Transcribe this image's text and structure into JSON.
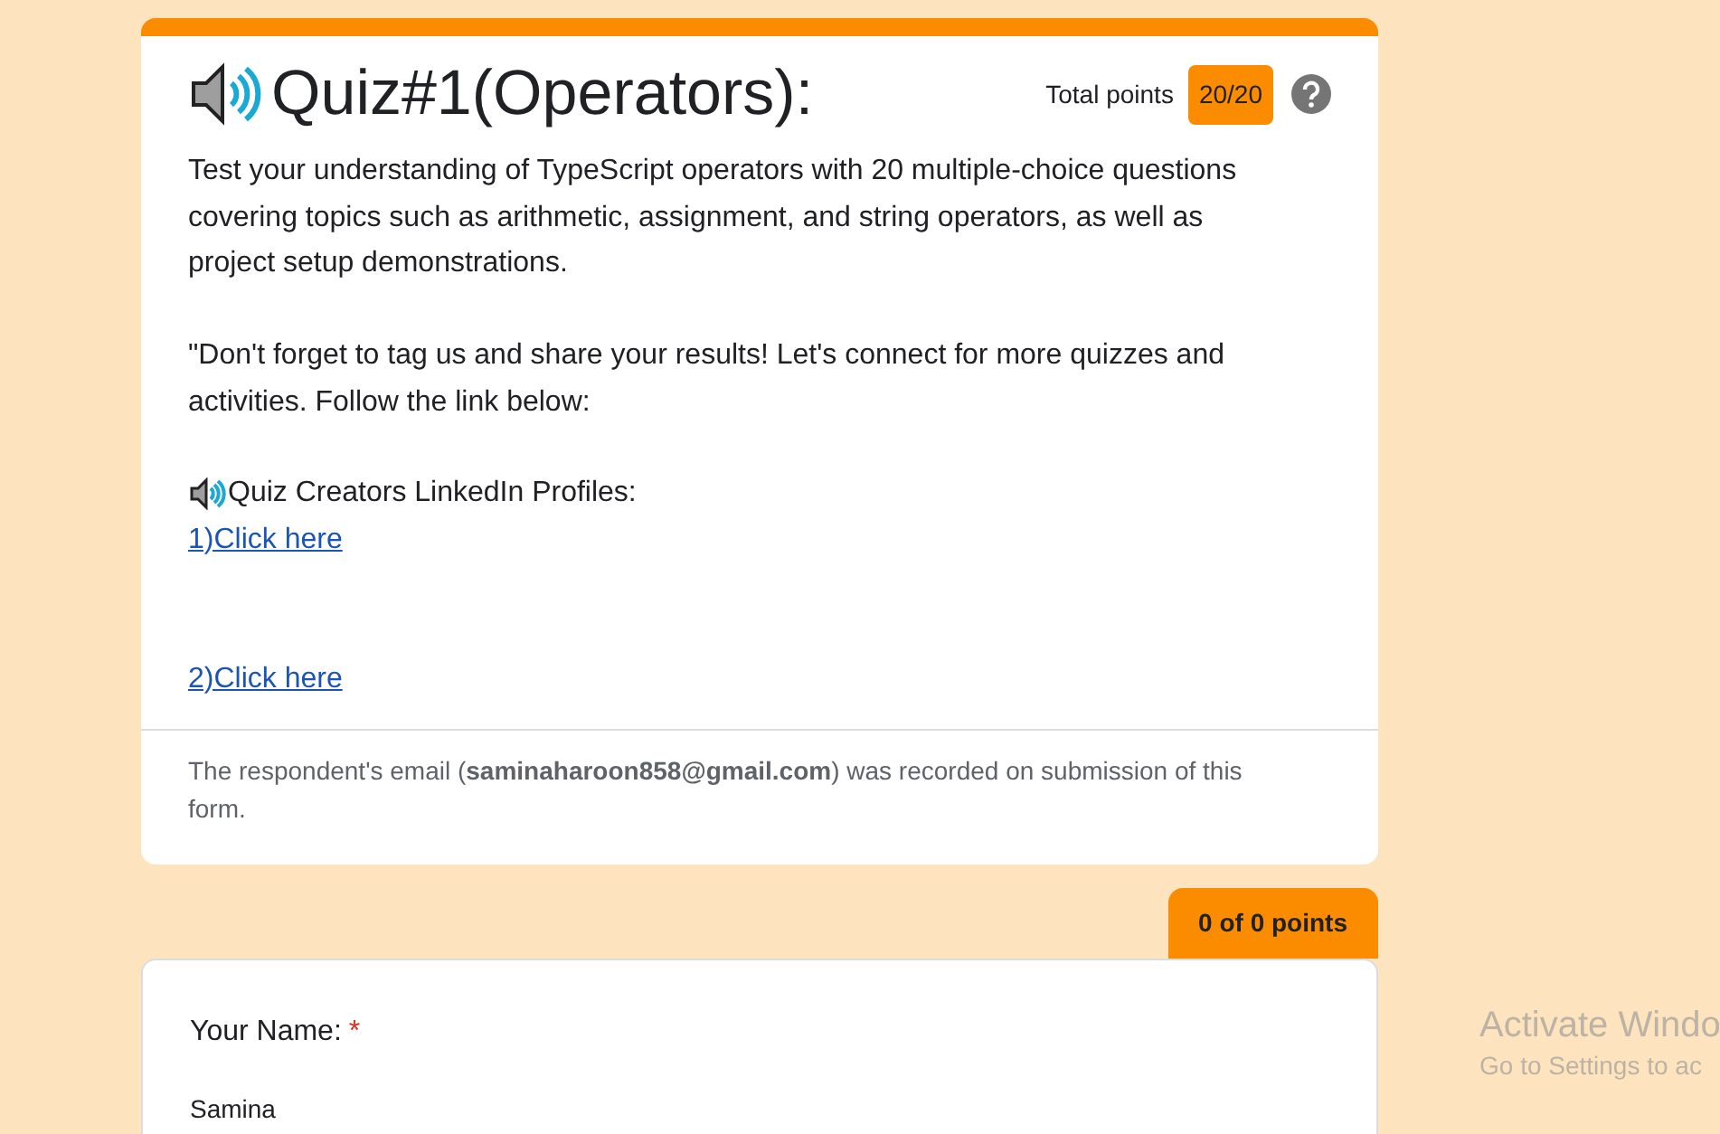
{
  "header_card": {
    "title": "Quiz#1(Operators):",
    "total_points_label": "Total points",
    "total_points": "20/20",
    "description": [
      "Test your understanding of TypeScript operators with 20 multiple-choice questions covering topics such as arithmetic, assignment, and string operators, as well as project setup demonstrations.",
      "\"Don't forget to tag us and share your results! Let's connect for more quizzes and activities. Follow the link below:"
    ],
    "links_heading": "Quiz Creators LinkedIn Profiles:",
    "links": [
      "1)Click here",
      "2)Click here"
    ],
    "email_note": "The respondent's email (**saminaharoon858@gmail.com**) was recorded on submission of this form."
  },
  "question": {
    "points": "0 of 0 points",
    "label": "Your Name:",
    "required": true,
    "required_mark": "*",
    "answer": "Samina"
  },
  "windows_notice": {
    "title": "Activate Windo",
    "subtitle": "Go to Settings to ac"
  }
}
